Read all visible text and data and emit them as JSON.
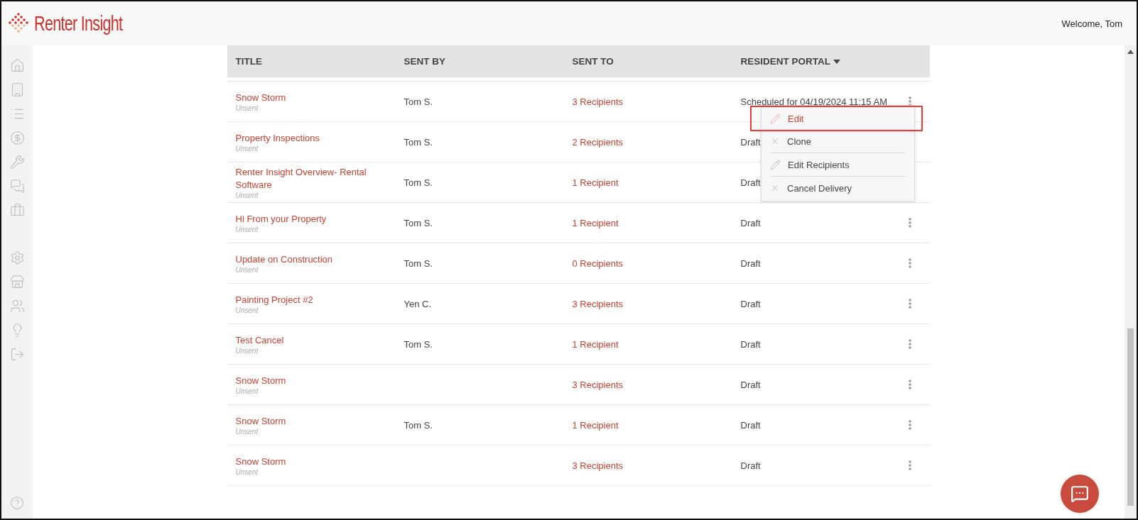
{
  "header": {
    "brand": "Renter Insight",
    "welcome": "Welcome, Tom"
  },
  "table": {
    "columns": [
      {
        "label": "TITLE",
        "sorted": false
      },
      {
        "label": "SENT BY",
        "sorted": false
      },
      {
        "label": "SENT TO",
        "sorted": false
      },
      {
        "label": "RESIDENT PORTAL",
        "sorted": true
      }
    ],
    "rows": [
      {
        "title": "Snow Storm",
        "status": "Unsent",
        "sent_by": "Tom S.",
        "sent_to": "3 Recipients",
        "portal": "Scheduled for 04/19/2024 11:15 AM"
      },
      {
        "title": "Property Inspections",
        "status": "Unsent",
        "sent_by": "Tom S.",
        "sent_to": "2 Recipients",
        "portal": "Draft"
      },
      {
        "title": "Renter Insight Overview- Rental Software",
        "status": "Unsent",
        "sent_by": "Tom S.",
        "sent_to": "1 Recipient",
        "portal": "Draft"
      },
      {
        "title": "Hi From your Property",
        "status": "Unsent",
        "sent_by": "Tom S.",
        "sent_to": "1 Recipient",
        "portal": "Draft"
      },
      {
        "title": "Update on Construction",
        "status": "Unsent",
        "sent_by": "Tom S.",
        "sent_to": "0 Recipients",
        "portal": "Draft"
      },
      {
        "title": "Painting Project #2",
        "status": "Unsent",
        "sent_by": "Yen C.",
        "sent_to": "3 Recipients",
        "portal": "Draft"
      },
      {
        "title": "Test Cancel",
        "status": "Unsent",
        "sent_by": "Tom S.",
        "sent_to": "1 Recipient",
        "portal": "Draft"
      },
      {
        "title": "Snow Storm",
        "status": "Unsent",
        "sent_to": "3 Recipients",
        "portal": "Draft"
      },
      {
        "title": "Snow Storm",
        "status": "Unsent",
        "sent_by": "Tom S.",
        "sent_to": "1 Recipient",
        "portal": "Draft"
      },
      {
        "title": "Snow Storm",
        "status": "Unsent",
        "sent_to": "3 Recipients",
        "portal": "Draft"
      }
    ]
  },
  "menu": {
    "items": [
      {
        "label": "Edit",
        "kind": "pencil",
        "selected": true
      },
      {
        "label": "Clone",
        "kind": "cross",
        "selected": false
      },
      {
        "label": "Edit Recipients",
        "kind": "pencil",
        "selected": false
      },
      {
        "label": "Cancel Delivery",
        "kind": "cross",
        "selected": false
      }
    ]
  }
}
